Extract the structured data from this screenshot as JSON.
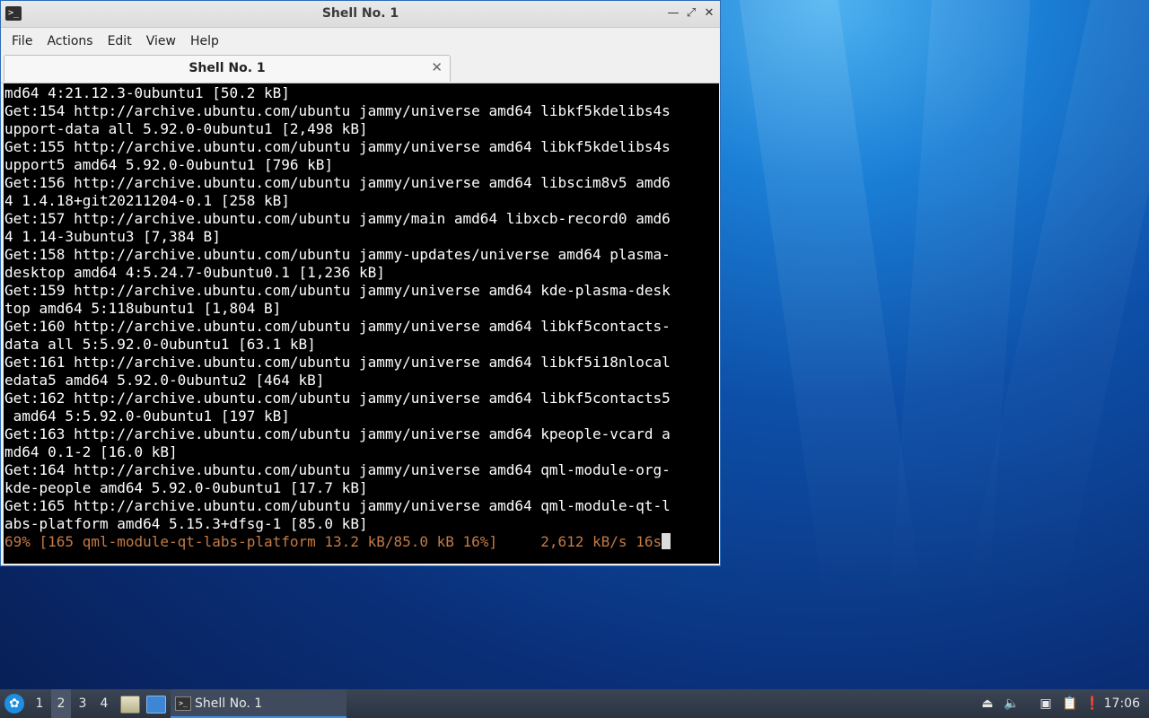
{
  "window": {
    "title": "Shell No. 1",
    "icons": {
      "app": "terminal-icon",
      "minimize": "minimize-icon",
      "maximize": "maximize-icon",
      "close": "close-icon"
    }
  },
  "menubar": {
    "items": [
      {
        "label": "File"
      },
      {
        "label": "Actions"
      },
      {
        "label": "Edit"
      },
      {
        "label": "View"
      },
      {
        "label": "Help"
      }
    ]
  },
  "tab": {
    "label": "Shell No. 1"
  },
  "terminal": {
    "lines": [
      "md64 4:21.12.3-0ubuntu1 [50.2 kB]",
      "Get:154 http://archive.ubuntu.com/ubuntu jammy/universe amd64 libkf5kdelibs4s",
      "upport-data all 5.92.0-0ubuntu1 [2,498 kB]",
      "Get:155 http://archive.ubuntu.com/ubuntu jammy/universe amd64 libkf5kdelibs4s",
      "upport5 amd64 5.92.0-0ubuntu1 [796 kB]",
      "Get:156 http://archive.ubuntu.com/ubuntu jammy/universe amd64 libscim8v5 amd6",
      "4 1.4.18+git20211204-0.1 [258 kB]",
      "Get:157 http://archive.ubuntu.com/ubuntu jammy/main amd64 libxcb-record0 amd6",
      "4 1.14-3ubuntu3 [7,384 B]",
      "Get:158 http://archive.ubuntu.com/ubuntu jammy-updates/universe amd64 plasma-",
      "desktop amd64 4:5.24.7-0ubuntu0.1 [1,236 kB]",
      "Get:159 http://archive.ubuntu.com/ubuntu jammy/universe amd64 kde-plasma-desk",
      "top amd64 5:118ubuntu1 [1,804 B]",
      "Get:160 http://archive.ubuntu.com/ubuntu jammy/universe amd64 libkf5contacts-",
      "data all 5:5.92.0-0ubuntu1 [63.1 kB]",
      "Get:161 http://archive.ubuntu.com/ubuntu jammy/universe amd64 libkf5i18nlocal",
      "edata5 amd64 5.92.0-0ubuntu2 [464 kB]",
      "Get:162 http://archive.ubuntu.com/ubuntu jammy/universe amd64 libkf5contacts5",
      " amd64 5:5.92.0-0ubuntu1 [197 kB]",
      "Get:163 http://archive.ubuntu.com/ubuntu jammy/universe amd64 kpeople-vcard a",
      "md64 0.1-2 [16.0 kB]",
      "Get:164 http://archive.ubuntu.com/ubuntu jammy/universe amd64 qml-module-org-",
      "kde-people amd64 5.92.0-0ubuntu1 [17.7 kB]",
      "Get:165 http://archive.ubuntu.com/ubuntu jammy/universe amd64 qml-module-qt-l",
      "abs-platform amd64 5.15.3+dfsg-1 [85.0 kB]"
    ],
    "progress_line": "69% [165 qml-module-qt-labs-platform 13.2 kB/85.0 kB 16%]     2,612 kB/s 16s",
    "progress_color": "#c47a45"
  },
  "taskbar": {
    "start_icon": "lxqt-menu-icon",
    "workspaces": [
      "1",
      "2",
      "3",
      "4"
    ],
    "active_workspace": "2",
    "launchers": [
      "file-manager-icon",
      "desktop-icon"
    ],
    "task": {
      "label": "Shell No. 1",
      "icon": "terminal-icon"
    },
    "tray": [
      "eject-icon",
      "volume-icon",
      "network-icon",
      "clipboard-icon",
      "update-notifier-icon"
    ],
    "clock": "17:06"
  }
}
